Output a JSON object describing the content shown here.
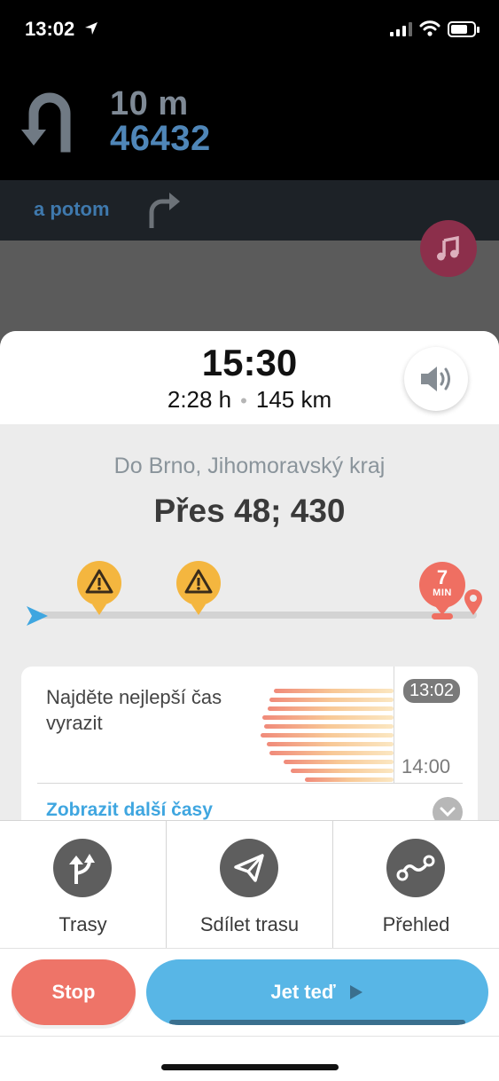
{
  "status_bar": {
    "time": "13:02",
    "battery_level": 0.6
  },
  "instruction": {
    "distance": "10 m",
    "street": "46432",
    "then_label": "a potom"
  },
  "summary": {
    "eta": "15:30",
    "duration": "2:28 h",
    "separator": "•",
    "distance": "145 km"
  },
  "route": {
    "destination": "Do Brno, Jihomoravský kraj",
    "via": "Přes 48; 430",
    "traffic": {
      "value": "7",
      "unit": "MIN"
    }
  },
  "best_time": {
    "text": "Najděte nejlepší čas vyrazit",
    "start_time": "13:02",
    "end_time": "14:00",
    "more_link": "Zobrazit další časy"
  },
  "actions": [
    {
      "label": "Trasy",
      "icon": "route-fork-icon"
    },
    {
      "label": "Sdílet trasu",
      "icon": "send-icon"
    },
    {
      "label": "Přehled",
      "icon": "route-overview-icon"
    }
  ],
  "buttons": {
    "stop": "Stop",
    "go": "Jet teď"
  },
  "colors": {
    "stop": "#ee7468",
    "go": "#58b6e6",
    "link": "#3fa6e0",
    "warning": "#f4b63f",
    "traffic": "#ef6f62"
  }
}
